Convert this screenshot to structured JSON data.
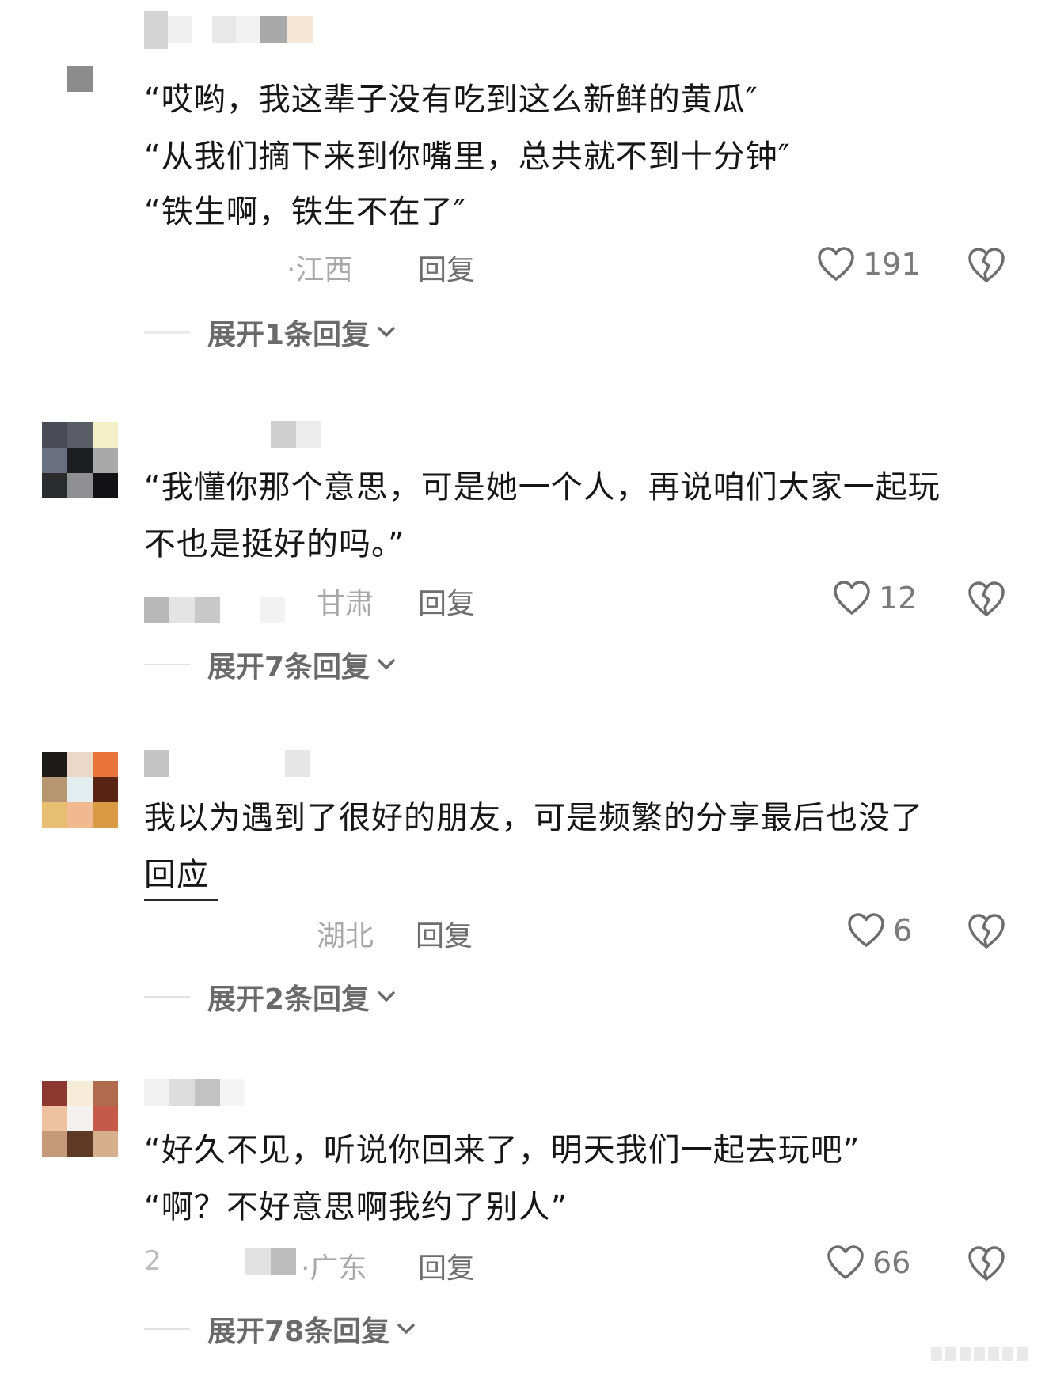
{
  "comments": [
    {
      "lines": [
        "“哎哟，我这辈子没有吃到这么新鲜的黄瓜″",
        "“从我们摘下来到你嘴里，总共就不到十分钟″",
        "“铁生啊，铁生不在了″"
      ],
      "location": "·江西",
      "reply_label": "回复",
      "likes": "191",
      "expand_label": "展开1条回复",
      "avatar_colors": [
        "#8c8c8c"
      ]
    },
    {
      "lines": [
        "“我懂你那个意思，可是她一个人，再说咱们大家一起玩",
        "不也是挺好的吗。”"
      ],
      "location": "甘肃",
      "reply_label": "回复",
      "likes": "12",
      "expand_label": "展开7条回复",
      "avatar_colors": [
        "#4a4c55",
        "#5b5d66",
        "#f3f0c8",
        "#6b6f82",
        "#1e1f22",
        "#a9a9aa",
        "#2b2c2e",
        "#8f8f92",
        "#121214"
      ]
    },
    {
      "lines": [
        "我以为遇到了很好的朋友，可是频繁的分享最后也没了",
        "回应"
      ],
      "location": "湖北",
      "reply_label": "回复",
      "likes": "6",
      "expand_label": "展开2条回复",
      "avatar_colors": [
        "#1d1a17",
        "#ecd8c8",
        "#e8743c",
        "#b79772",
        "#e3eef1",
        "#5a2414",
        "#e8bf72",
        "#f2b88f",
        "#d99a43"
      ]
    },
    {
      "lines": [
        "“好久不见，听说你回来了，明天我们一起去玩吧”",
        "“啊？不好意思啊我约了别人”"
      ],
      "prefix": "2",
      "location": "·广东",
      "reply_label": "回复",
      "likes": "66",
      "expand_label": "展开78条回复",
      "avatar_colors": [
        "#8c3830",
        "#f6ecd8",
        "#b06a4c",
        "#eec1a0",
        "#f4f0ee",
        "#c65a48",
        "#c69a78",
        "#5e3a26",
        "#d6b08c"
      ]
    }
  ]
}
